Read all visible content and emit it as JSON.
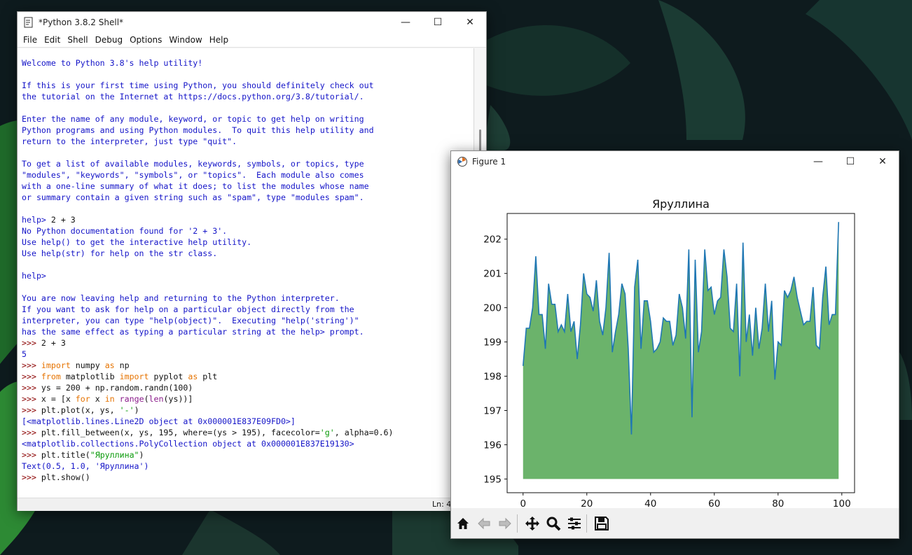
{
  "shell": {
    "title": "*Python 3.8.2 Shell*",
    "menu": [
      "File",
      "Edit",
      "Shell",
      "Debug",
      "Options",
      "Window",
      "Help"
    ],
    "lines": [
      [
        [
          "out",
          "Welcome to Python 3.8's help utility!"
        ]
      ],
      [],
      [
        [
          "out",
          "If this is your first time using Python, you should definitely check out"
        ]
      ],
      [
        [
          "out",
          "the tutorial on the Internet at https://docs.python.org/3.8/tutorial/."
        ]
      ],
      [],
      [
        [
          "out",
          "Enter the name of any module, keyword, or topic to get help on writing"
        ]
      ],
      [
        [
          "out",
          "Python programs and using Python modules.  To quit this help utility and"
        ]
      ],
      [
        [
          "out",
          "return to the interpreter, just type \"quit\"."
        ]
      ],
      [],
      [
        [
          "out",
          "To get a list of available modules, keywords, symbols, or topics, type"
        ]
      ],
      [
        [
          "out",
          "\"modules\", \"keywords\", \"symbols\", or \"topics\".  Each module also comes"
        ]
      ],
      [
        [
          "out",
          "with a one-line summary of what it does; to list the modules whose name"
        ]
      ],
      [
        [
          "out",
          "or summary contain a given string such as \"spam\", type \"modules spam\"."
        ]
      ],
      [],
      [
        [
          "out",
          "help> "
        ],
        [
          "code",
          "2 + 3"
        ]
      ],
      [
        [
          "out",
          "No Python documentation found for '2 + 3'."
        ]
      ],
      [
        [
          "out",
          "Use help() to get the interactive help utility."
        ]
      ],
      [
        [
          "out",
          "Use help(str) for help on the str class."
        ]
      ],
      [],
      [
        [
          "out",
          "help> "
        ]
      ],
      [],
      [
        [
          "out",
          "You are now leaving help and returning to the Python interpreter."
        ]
      ],
      [
        [
          "out",
          "If you want to ask for help on a particular object directly from the"
        ]
      ],
      [
        [
          "out",
          "interpreter, you can type \"help(object)\".  Executing \"help('string')\""
        ]
      ],
      [
        [
          "out",
          "has the same effect as typing a particular string at the help> prompt."
        ]
      ],
      [
        [
          "prompt",
          ">>> "
        ],
        [
          "code",
          "2 + 3"
        ]
      ],
      [
        [
          "out",
          "5"
        ]
      ],
      [
        [
          "prompt",
          ">>> "
        ],
        [
          "kw",
          "import"
        ],
        [
          "code",
          " numpy "
        ],
        [
          "kw",
          "as"
        ],
        [
          "code",
          " np"
        ]
      ],
      [
        [
          "prompt",
          ">>> "
        ],
        [
          "kw",
          "from"
        ],
        [
          "code",
          " matplotlib "
        ],
        [
          "kw",
          "import"
        ],
        [
          "code",
          " pyplot "
        ],
        [
          "kw",
          "as"
        ],
        [
          "code",
          " plt"
        ]
      ],
      [
        [
          "prompt",
          ">>> "
        ],
        [
          "code",
          "ys = 200 + np.random.randn(100)"
        ]
      ],
      [
        [
          "prompt",
          ">>> "
        ],
        [
          "code",
          "x = [x "
        ],
        [
          "kw",
          "for"
        ],
        [
          "code",
          " x "
        ],
        [
          "kw",
          "in"
        ],
        [
          "code",
          " "
        ],
        [
          "bi",
          "range"
        ],
        [
          "code",
          "("
        ],
        [
          "bi",
          "len"
        ],
        [
          "code",
          "(ys))]"
        ]
      ],
      [
        [
          "prompt",
          ">>> "
        ],
        [
          "code",
          "plt.plot(x, ys, "
        ],
        [
          "str",
          "'-'"
        ],
        [
          "code",
          ")"
        ]
      ],
      [
        [
          "out",
          "[<matplotlib.lines.Line2D object at 0x000001E837E09FD0>]"
        ]
      ],
      [
        [
          "prompt",
          ">>> "
        ],
        [
          "code",
          "plt.fill_between(x, ys, 195, where=(ys > 195), facecolor="
        ],
        [
          "str",
          "'g'"
        ],
        [
          "code",
          ", alpha=0.6)"
        ]
      ],
      [
        [
          "out",
          "<matplotlib.collections.PolyCollection object at 0x000001E837E19130>"
        ]
      ],
      [
        [
          "prompt",
          ">>> "
        ],
        [
          "code",
          "plt.title("
        ],
        [
          "str",
          "\"Яруллина\""
        ],
        [
          "code",
          ")"
        ]
      ],
      [
        [
          "out",
          "Text(0.5, 1.0, 'Яруллина')"
        ]
      ],
      [
        [
          "prompt",
          ">>> "
        ],
        [
          "code",
          "plt.show()"
        ]
      ]
    ],
    "status": "Ln: 4"
  },
  "figure": {
    "title": "Figure 1",
    "toolbar": [
      "home-icon",
      "back-icon",
      "forward-icon",
      "pan-icon",
      "zoom-icon",
      "configure-icon",
      "save-icon"
    ]
  },
  "colors": {
    "fill": "#3a9a3a",
    "line": "#1f77b4"
  },
  "chart_data": {
    "type": "area",
    "title": "Яруллина",
    "xlabel": "",
    "ylabel": "",
    "xlim": [
      -5,
      104
    ],
    "ylim": [
      194.6,
      202.75
    ],
    "xticks": [
      0,
      20,
      40,
      60,
      80,
      100
    ],
    "yticks": [
      195,
      196,
      197,
      198,
      199,
      200,
      201,
      202
    ],
    "fill_baseline": 195,
    "x": [
      0,
      1,
      2,
      3,
      4,
      5,
      6,
      7,
      8,
      9,
      10,
      11,
      12,
      13,
      14,
      15,
      16,
      17,
      18,
      19,
      20,
      21,
      22,
      23,
      24,
      25,
      26,
      27,
      28,
      29,
      30,
      31,
      32,
      33,
      34,
      35,
      36,
      37,
      38,
      39,
      40,
      41,
      42,
      43,
      44,
      45,
      46,
      47,
      48,
      49,
      50,
      51,
      52,
      53,
      54,
      55,
      56,
      57,
      58,
      59,
      60,
      61,
      62,
      63,
      64,
      65,
      66,
      67,
      68,
      69,
      70,
      71,
      72,
      73,
      74,
      75,
      76,
      77,
      78,
      79,
      80,
      81,
      82,
      83,
      84,
      85,
      86,
      87,
      88,
      89,
      90,
      91,
      92,
      93,
      94,
      95,
      96,
      97,
      98,
      99
    ],
    "y": [
      198.3,
      199.4,
      199.4,
      200.0,
      201.5,
      199.8,
      199.8,
      198.8,
      200.7,
      200.1,
      200.1,
      199.3,
      199.5,
      199.3,
      200.4,
      199.3,
      199.6,
      198.5,
      199.5,
      201.0,
      200.4,
      200.3,
      199.9,
      200.8,
      199.6,
      199.2,
      200.0,
      201.6,
      198.7,
      199.3,
      199.8,
      200.7,
      200.4,
      198.8,
      196.3,
      200.6,
      201.4,
      198.8,
      200.2,
      200.2,
      199.6,
      198.7,
      198.8,
      199.0,
      199.7,
      199.6,
      199.6,
      198.9,
      199.2,
      200.4,
      200.0,
      199.1,
      201.7,
      196.8,
      201.4,
      198.7,
      199.3,
      201.7,
      200.5,
      200.6,
      199.8,
      200.2,
      200.3,
      201.7,
      200.9,
      199.4,
      199.3,
      200.7,
      198.0,
      201.9,
      199.0,
      199.8,
      198.6,
      200.0,
      198.8,
      199.4,
      200.7,
      199.3,
      200.2,
      197.9,
      199.0,
      198.9,
      200.5,
      200.3,
      200.5,
      200.9,
      200.3,
      199.9,
      199.5,
      199.6,
      199.6,
      200.6,
      198.9,
      198.8,
      200.3,
      201.2,
      199.5,
      199.8,
      199.8,
      202.5
    ]
  }
}
